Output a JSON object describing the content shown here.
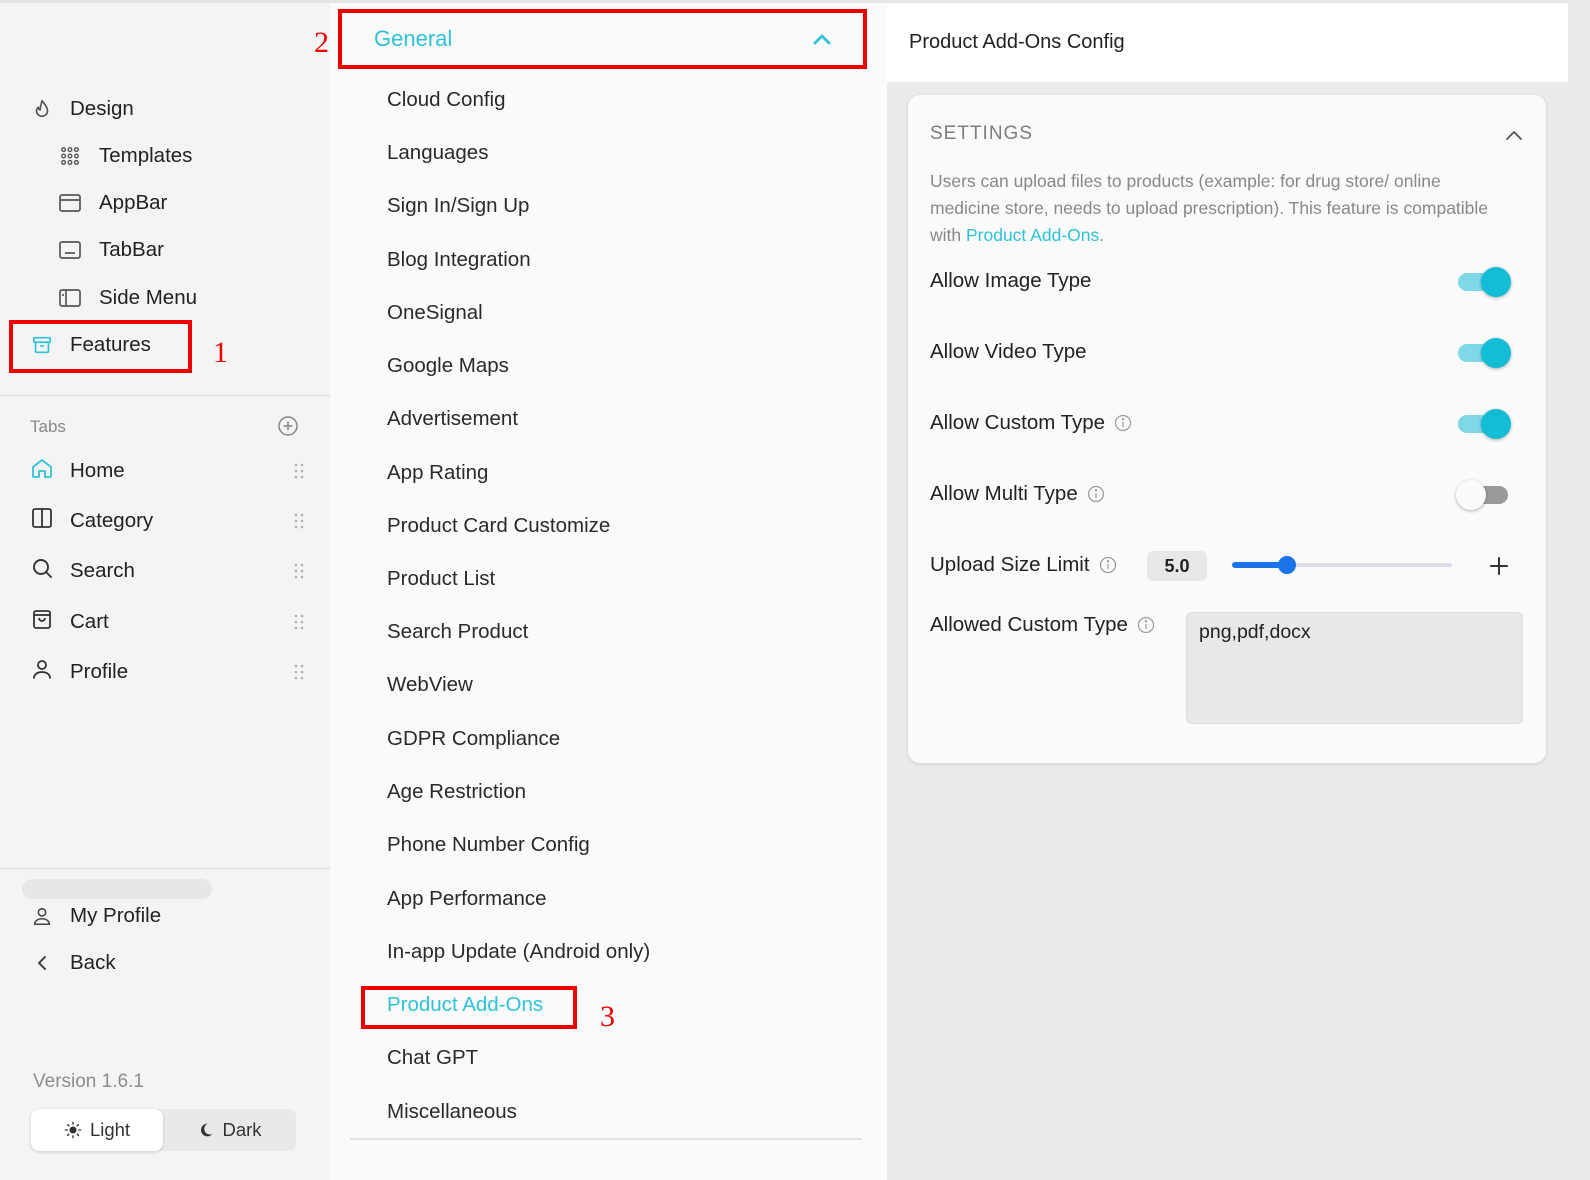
{
  "sidebar": {
    "design": "Design",
    "templates": "Templates",
    "appbar": "AppBar",
    "tabbar": "TabBar",
    "side_menu": "Side Menu",
    "features": "Features",
    "tabs_title": "Tabs",
    "tabs": [
      {
        "label": "Home",
        "icon": "home-icon"
      },
      {
        "label": "Category",
        "icon": "category-icon"
      },
      {
        "label": "Search",
        "icon": "search-icon"
      },
      {
        "label": "Cart",
        "icon": "cart-icon"
      },
      {
        "label": "Profile",
        "icon": "profile-icon"
      }
    ],
    "my_profile": "My Profile",
    "back": "Back",
    "version": "Version 1.6.1",
    "theme": {
      "light": "Light",
      "dark": "Dark",
      "selected": "Light"
    }
  },
  "menu": {
    "section": "General",
    "items": [
      "Cloud Config",
      "Languages",
      "Sign In/Sign Up",
      "Blog Integration",
      "OneSignal",
      "Google Maps",
      "Advertisement",
      "App Rating",
      "Product Card Customize",
      "Product List",
      "Search Product",
      "WebView",
      "GDPR Compliance",
      "Age Restriction",
      "Phone Number Config",
      "App Performance",
      "In-app Update (Android only)",
      "Product Add-Ons",
      "Chat GPT",
      "Miscellaneous"
    ],
    "active_item": "Product Add-Ons"
  },
  "panel": {
    "title": "Product Add-Ons Config",
    "settings_title": "SETTINGS",
    "description_text": "Users can upload files to products (example: for drug store/ online medicine store, needs to upload prescription). This feature is compatible with ",
    "description_link": "Product Add-Ons",
    "description_end": ".",
    "allow_image_type": {
      "label": "Allow Image Type",
      "on": true
    },
    "allow_video_type": {
      "label": "Allow Video Type",
      "on": true
    },
    "allow_custom_type": {
      "label": "Allow Custom Type",
      "on": true
    },
    "allow_multi_type": {
      "label": "Allow Multi Type",
      "on": false
    },
    "upload_size_limit": {
      "label": "Upload Size Limit",
      "value": "5.0",
      "slider_fraction": 0.25
    },
    "allowed_custom_type": {
      "label": "Allowed Custom Type",
      "value": "png,pdf,docx"
    }
  },
  "annotations": {
    "one": "1",
    "two": "2",
    "three": "3"
  },
  "colors": {
    "accent": "#2ec3d8",
    "toggle_on": "#14bdd6",
    "slider": "#1a73e8",
    "annotation": "#ef0000"
  }
}
